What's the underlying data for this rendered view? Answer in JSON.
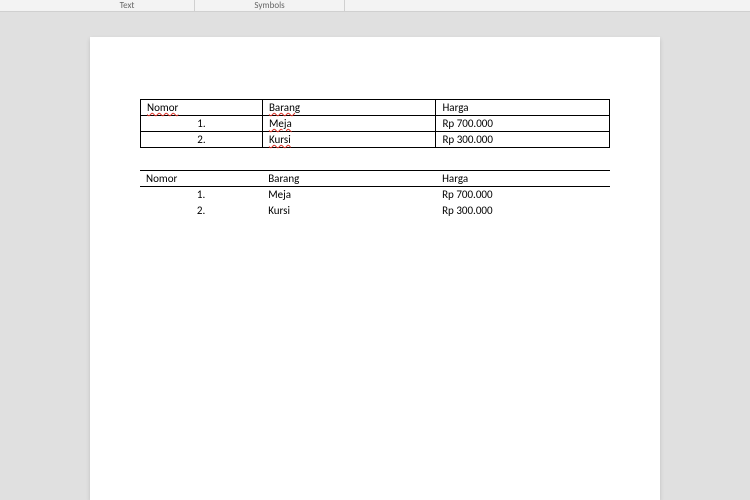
{
  "ribbon": {
    "text_label": "Text",
    "symbols_label": "Symbols"
  },
  "table1": {
    "headers": {
      "nomor": "Nomor",
      "barang": "Barang",
      "harga": "Harga"
    },
    "rows": [
      {
        "nomor": "1.",
        "barang": "Meja",
        "harga": "Rp 700.000"
      },
      {
        "nomor": "2.",
        "barang": "Kursi",
        "harga": "Rp 300.000"
      }
    ]
  },
  "table2": {
    "headers": {
      "nomor": "Nomor",
      "barang": "Barang",
      "harga": "Harga"
    },
    "rows": [
      {
        "nomor": "1.",
        "barang": "Meja",
        "harga": "Rp 700.000"
      },
      {
        "nomor": "2.",
        "barang": "Kursi",
        "harga": "Rp 300.000"
      }
    ]
  }
}
